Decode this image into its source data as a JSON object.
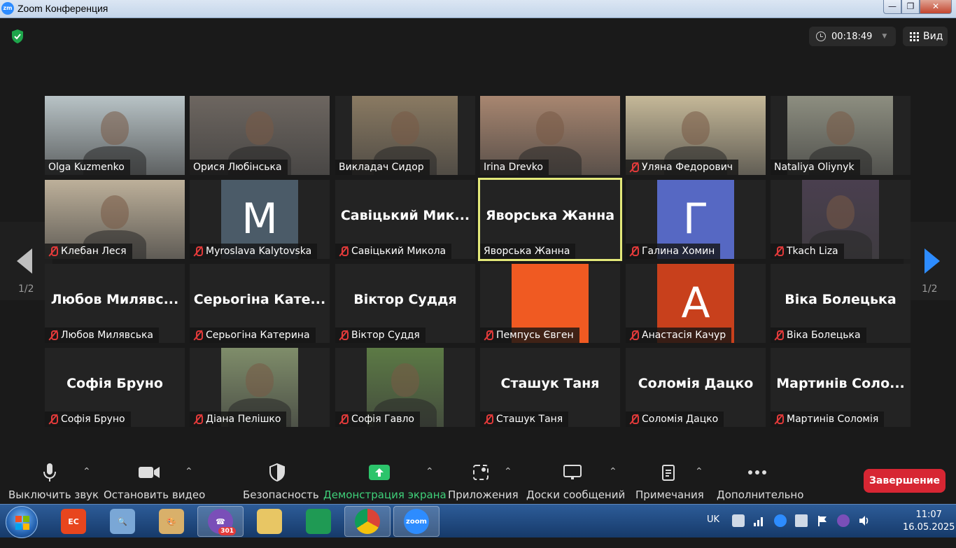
{
  "window": {
    "title": "Zoom Конференция",
    "min": "—",
    "max": "❐",
    "close": "✕"
  },
  "topbar": {
    "timer": "00:18:49",
    "view_label": "Вид"
  },
  "gallery": {
    "page_left": "1/2",
    "page_right": "1/2",
    "tiles": [
      {
        "name": "Olga Kuzmenko",
        "muted": false,
        "kind": "video",
        "color": "#b8c3c6"
      },
      {
        "name": "Орися Любінська",
        "muted": false,
        "kind": "video",
        "color": "#6d6660"
      },
      {
        "name": "Викладач Сидор",
        "muted": false,
        "kind": "video",
        "color": "#8a7a62"
      },
      {
        "name": "Irina Drevko",
        "muted": false,
        "kind": "video",
        "color": "#a88670"
      },
      {
        "name": "Уляна Федорович",
        "muted": true,
        "kind": "video",
        "color": "#c5b898"
      },
      {
        "name": "Nataliya Oliynyk",
        "muted": false,
        "kind": "video",
        "color": "#8d8e80"
      },
      {
        "name": "Клебан Леся",
        "muted": true,
        "kind": "video",
        "color": "#bdb09a"
      },
      {
        "name": "Myroslava Kalytovska",
        "muted": true,
        "kind": "avatar",
        "letter": "M",
        "color": "#4b5b68"
      },
      {
        "name": "Савіцький Микола",
        "muted": true,
        "kind": "text",
        "big": "Савіцький Мик..."
      },
      {
        "name": "Яворська Жанна",
        "muted": false,
        "kind": "text",
        "big": "Яворська Жанна",
        "active": true
      },
      {
        "name": "Галина Хомин",
        "muted": true,
        "kind": "avatar",
        "letter": "Г",
        "color": "#5668c3"
      },
      {
        "name": "Tkach Liza",
        "muted": true,
        "kind": "video",
        "color": "#4a3f4f"
      },
      {
        "name": "Любов Милявська",
        "muted": true,
        "kind": "text",
        "big": "Любов Милявс..."
      },
      {
        "name": "Серьогіна Катерина",
        "muted": true,
        "kind": "text",
        "big": "Серьогіна Кате..."
      },
      {
        "name": "Віктор Суддя",
        "muted": true,
        "kind": "text",
        "big": "Віктор Суддя"
      },
      {
        "name": "Пемпусь Євген",
        "muted": true,
        "kind": "avatar",
        "letter": "",
        "color": "#f05a22"
      },
      {
        "name": "Анастасія Качур",
        "muted": true,
        "kind": "avatar",
        "letter": "А",
        "color": "#c8401c"
      },
      {
        "name": "Віка Болецька",
        "muted": true,
        "kind": "text",
        "big": "Віка Болецька"
      },
      {
        "name": "Софія Бруно",
        "muted": true,
        "kind": "text",
        "big": "Софія Бруно"
      },
      {
        "name": "Діана Пелішко",
        "muted": true,
        "kind": "video",
        "color": "#7f8d6a"
      },
      {
        "name": "Софія Гавло",
        "muted": true,
        "kind": "video",
        "color": "#5c7a45"
      },
      {
        "name": "Сташук Таня",
        "muted": true,
        "kind": "text",
        "big": "Сташук Таня"
      },
      {
        "name": "Соломія Дацко",
        "muted": true,
        "kind": "text",
        "big": "Соломія Дацко"
      },
      {
        "name": "Мартинів Соломія",
        "muted": true,
        "kind": "text",
        "big": "Мартинів Соло..."
      }
    ]
  },
  "toolbar": {
    "mute": "Выключить звук",
    "video": "Остановить видео",
    "security": "Безопасность",
    "share": "Демонстрация экрана",
    "apps": "Приложения",
    "whiteboards": "Доски сообщений",
    "notes": "Примечания",
    "more": "Дополнительно",
    "end": "Завершение"
  },
  "taskbar": {
    "viber_badge": "301",
    "zoom_label": "zoom",
    "lang": "UK",
    "time": "11:07",
    "date": "16.05.2025"
  },
  "colors": {
    "accent_green": "#3fd17a",
    "end_red": "#d72633",
    "active_speaker": "#e4e97a"
  }
}
